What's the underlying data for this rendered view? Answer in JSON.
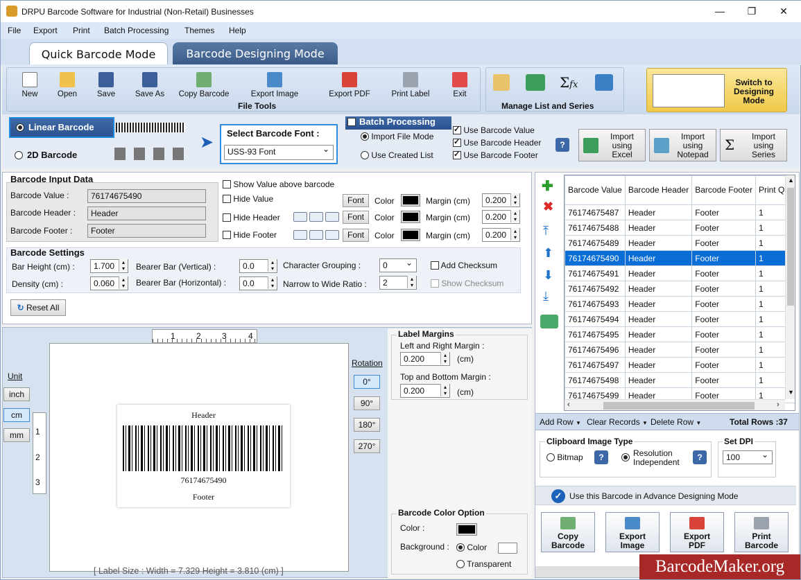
{
  "window": {
    "title": "DRPU Barcode Software for Industrial (Non-Retail) Businesses"
  },
  "menu": [
    "File",
    "Export",
    "Print",
    "Batch Processing",
    "Themes",
    "Help"
  ],
  "tabs": {
    "quick": "Quick Barcode Mode",
    "designing": "Barcode Designing Mode"
  },
  "toolbar": {
    "new": "New",
    "open": "Open",
    "save": "Save",
    "save_as": "Save As",
    "copy_barcode": "Copy Barcode",
    "export_image": "Export Image",
    "export_pdf": "Export PDF",
    "print_label": "Print Label",
    "exit": "Exit",
    "file_tools": "File Tools",
    "manage_list": "Manage List and Series",
    "switch_label": "Switch to Designing Mode"
  },
  "barcode_type": {
    "linear": "Linear Barcode",
    "twod": "2D Barcode"
  },
  "font": {
    "label": "Select Barcode Font :",
    "value": "USS-93 Font"
  },
  "batch": {
    "title": "Batch Processing",
    "import_file": "Import File Mode",
    "use_created": "Use Created List",
    "use_value": "Use Barcode Value",
    "use_header": "Use Barcode Header",
    "use_footer": "Use Barcode Footer",
    "import_excel": "Import using Excel",
    "import_notepad": "Import using Notepad",
    "import_series": "Import using Series"
  },
  "input": {
    "title": "Barcode Input Data",
    "value_label": "Barcode Value :",
    "value": "76174675490",
    "header_label": "Barcode Header :",
    "header": "Header",
    "footer_label": "Barcode Footer :",
    "footer": "Footer",
    "show_above": "Show Value above barcode",
    "hide_value": "Hide Value",
    "hide_header": "Hide Header",
    "hide_footer": "Hide Footer",
    "font_btn": "Font",
    "color_lbl": "Color",
    "margin_lbl": "Margin (cm)",
    "margin_value": "0.200",
    "margin_header": "0.200",
    "margin_footer": "0.200"
  },
  "settings": {
    "title": "Barcode Settings",
    "bar_height_label": "Bar Height (cm) :",
    "bar_height": "1.700",
    "density_label": "Density (cm) :",
    "density": "0.060",
    "bearer_v_label": "Bearer Bar (Vertical) :",
    "bearer_v": "0.0",
    "bearer_h_label": "Bearer Bar (Horizontal) :",
    "bearer_h": "0.0",
    "char_group_label": "Character Grouping :",
    "char_group": "0",
    "ratio_label": "Narrow to Wide Ratio :",
    "ratio": "2",
    "add_checksum": "Add Checksum",
    "show_checksum": "Show Checksum",
    "reset_all": "Reset All"
  },
  "preview": {
    "unit_label": "Unit",
    "units": [
      "inch",
      "cm",
      "mm"
    ],
    "ruler_top": [
      "1",
      "2",
      "3",
      "4"
    ],
    "ruler_left": [
      "1",
      "2",
      "3"
    ],
    "header": "Header",
    "value": "76174675490",
    "footer": "Footer",
    "rotation_label": "Rotation",
    "rotations": [
      "0°",
      "90°",
      "180°",
      "270°"
    ],
    "label_size": "[ Label Size : Width = 7.329  Height = 3.810 (cm) ]"
  },
  "label_margins": {
    "title": "Label Margins",
    "lr_label": "Left and Right Margin :",
    "lr_value": "0.200",
    "tb_label": "Top and Bottom Margin :",
    "tb_value": "0.200",
    "unit": "(cm)"
  },
  "color_option": {
    "title": "Barcode Color Option",
    "color_label": "Color :",
    "background_label": "Background :",
    "color_opt": "Color",
    "transparent_opt": "Transparent"
  },
  "grid": {
    "headers": [
      "Barcode Value",
      "Barcode Header",
      "Barcode Footer",
      "Print Quantity"
    ],
    "rows": [
      [
        "76174675487",
        "Header",
        "Footer",
        "1"
      ],
      [
        "76174675488",
        "Header",
        "Footer",
        "1"
      ],
      [
        "76174675489",
        "Header",
        "Footer",
        "1"
      ],
      [
        "76174675490",
        "Header",
        "Footer",
        "1"
      ],
      [
        "76174675491",
        "Header",
        "Footer",
        "1"
      ],
      [
        "76174675492",
        "Header",
        "Footer",
        "1"
      ],
      [
        "76174675493",
        "Header",
        "Footer",
        "1"
      ],
      [
        "76174675494",
        "Header",
        "Footer",
        "1"
      ],
      [
        "76174675495",
        "Header",
        "Footer",
        "1"
      ],
      [
        "76174675496",
        "Header",
        "Footer",
        "1"
      ],
      [
        "76174675497",
        "Header",
        "Footer",
        "1"
      ],
      [
        "76174675498",
        "Header",
        "Footer",
        "1"
      ],
      [
        "76174675499",
        "Header",
        "Footer",
        "1"
      ]
    ],
    "selected_index": 3,
    "add_row": "Add Row",
    "clear_records": "Clear Records",
    "delete_row": "Delete Row",
    "total_rows": "Total Rows :37"
  },
  "clipboard": {
    "title": "Clipboard Image Type",
    "bitmap": "Bitmap",
    "resolution": "Resolution Independent"
  },
  "dpi": {
    "title": "Set DPI",
    "value": "100"
  },
  "advance": "Use this Barcode in Advance Designing Mode",
  "bottom_buttons": {
    "copy": "Copy Barcode",
    "export_image": "Export Image",
    "export_pdf": "Export PDF",
    "print": "Print Barcode"
  },
  "watermark": "BarcodeMaker.org",
  "colors": {
    "accent": "#0a6ed6",
    "tab_active": "#ffffff",
    "tab_inactive": "#3f5f8a",
    "switch_bg": "#f7d768",
    "watermark_bg": "#a82828"
  }
}
